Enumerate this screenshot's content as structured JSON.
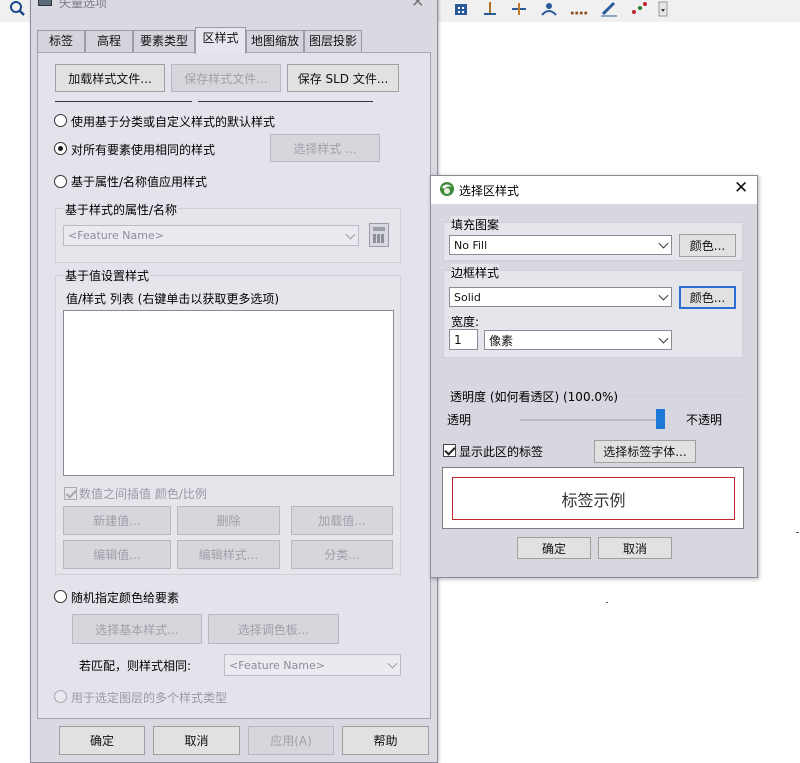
{
  "toolbar": {
    "icons": [
      "zoom-icon",
      "building-icon",
      "anchor-icon",
      "ruler-icon",
      "profile-icon",
      "dots-icon",
      "pen-icon",
      "nodes-icon",
      "dropdown-icon"
    ]
  },
  "main_dialog": {
    "title": "矢量选项",
    "tabs": [
      "标签",
      "高程",
      "要素类型",
      "区样式",
      "地图缩放",
      "图层投影"
    ],
    "active_tab": "区样式",
    "load_style_button": "加载样式文件...",
    "save_style_button": "保存样式文件...",
    "save_sld_button": "保存 SLD 文件...",
    "radio_default": "使用基于分类或自定义样式的默认样式",
    "radio_same": "对所有要素使用相同的样式",
    "select_style_button": "选择样式 ...",
    "radio_attribute": "基于属性/名称值应用样式",
    "attr_group_label": "基于样式的属性/名称",
    "attr_combo_value": "<Feature Name>",
    "value_group_label": "基于值设置样式",
    "value_list_label": "值/样式 列表 (右键单击以获取更多选项)",
    "interpolate_checkbox": "数值之间插值 颜色/比例",
    "new_value_button": "新建值...",
    "delete_button": "删除",
    "load_value_button": "加载值...",
    "edit_value_button": "编辑值...",
    "edit_style_button": "编辑样式...",
    "classify_button": "分类...",
    "radio_random": "随机指定颜色给要素",
    "select_base_style_button": "选择基本样式...",
    "select_palette_button": "选择调色板...",
    "match_label": "若匹配，则样式相同:",
    "match_combo_value": "<Feature Name>",
    "radio_multi": "用于选定图层的多个样式类型",
    "ok_button": "确定",
    "cancel_button": "取消",
    "apply_button": "应用(A)",
    "help_button": "帮助"
  },
  "area_style_dialog": {
    "title": "选择区样式",
    "fill_group_label": "填充图案",
    "fill_value": "No Fill",
    "fill_color_button": "颜色...",
    "border_group_label": "边框样式",
    "border_value": "Solid",
    "border_color_button": "颜色...",
    "width_label": "宽度:",
    "width_value": "1",
    "width_unit": "像素",
    "transparency_label": "透明度 (如何看透区) (100.0%)",
    "transparent_label": "透明",
    "opaque_label": "不透明",
    "transparency_value": 1.0,
    "show_label_checkbox": "显示此区的标签",
    "select_font_button": "选择标签字体...",
    "sample_label": "标签示例",
    "ok_button": "确定",
    "cancel_button": "取消",
    "colors": {
      "slider_thumb": "#1e78d7",
      "sample_border": "#c0272d",
      "focus": "#2c6ed5"
    }
  }
}
